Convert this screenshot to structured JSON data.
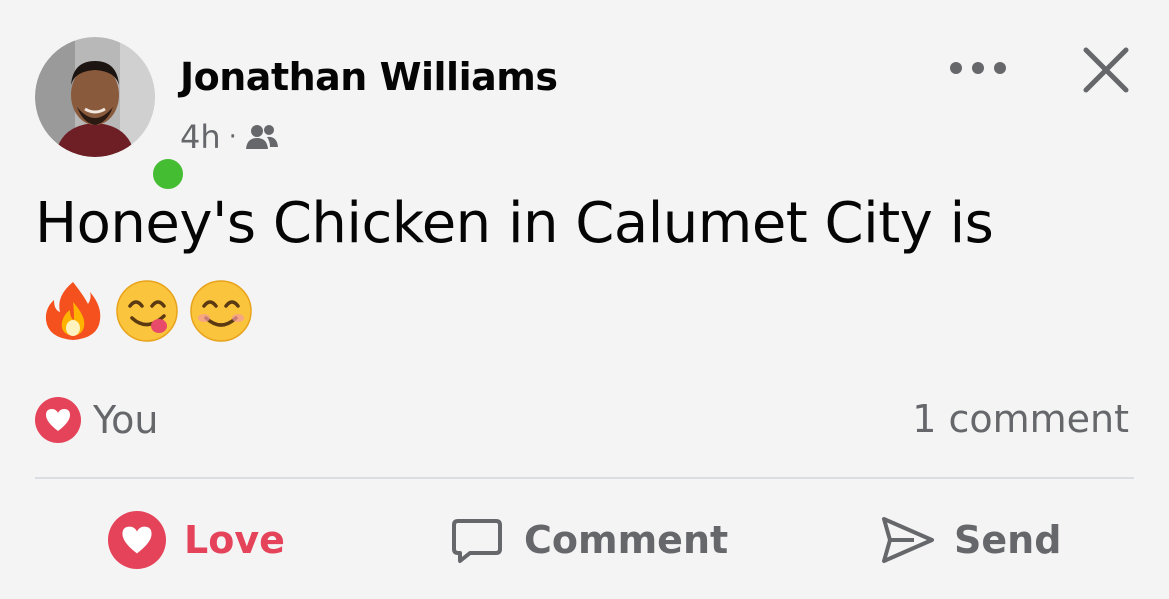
{
  "post": {
    "author": "Jonathan Williams",
    "time": "4h",
    "separator": "·",
    "audience_icon": "friends-icon",
    "text": "Honey's Chicken in Calumet City is",
    "emojis": [
      "fire-emoji",
      "yum-face-emoji",
      "smiling-face-emoji"
    ]
  },
  "reactions": {
    "type": "love",
    "by": "You",
    "comments": "1 comment"
  },
  "actions": {
    "love_label": "Love",
    "comment_label": "Comment",
    "send_label": "Send"
  },
  "colors": {
    "love": "#e5435a",
    "online": "#44bd32",
    "secondary_text": "#65676b",
    "background": "#f4f4f4"
  }
}
